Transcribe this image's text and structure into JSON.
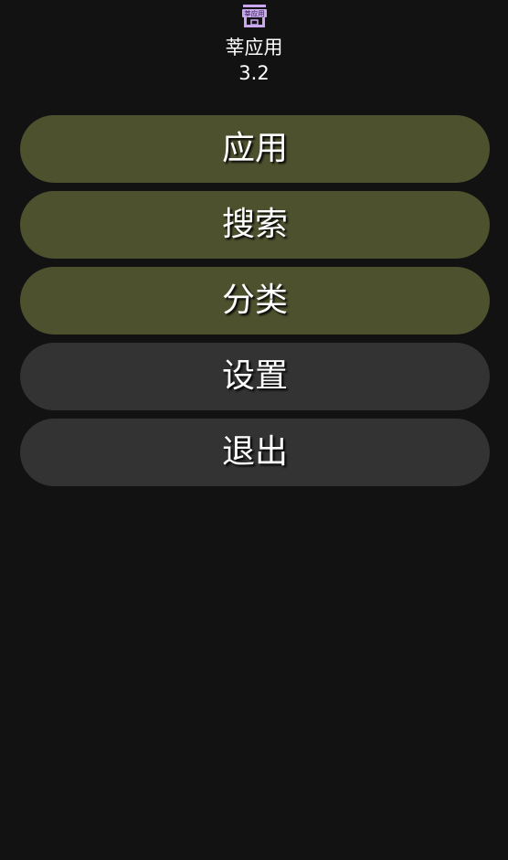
{
  "header": {
    "logo_icon": "store-icon",
    "logo_text": "莘应用",
    "app_name": "莘应用",
    "version": "3.2"
  },
  "menu": {
    "items": [
      {
        "label": "应用",
        "style": "primary"
      },
      {
        "label": "搜索",
        "style": "primary"
      },
      {
        "label": "分类",
        "style": "primary"
      },
      {
        "label": "设置",
        "style": "secondary"
      },
      {
        "label": "退出",
        "style": "secondary"
      }
    ]
  },
  "colors": {
    "background": "#121212",
    "primary_button": "#4d512e",
    "secondary_button": "#333333",
    "logo_accent": "#c9a8f0"
  }
}
